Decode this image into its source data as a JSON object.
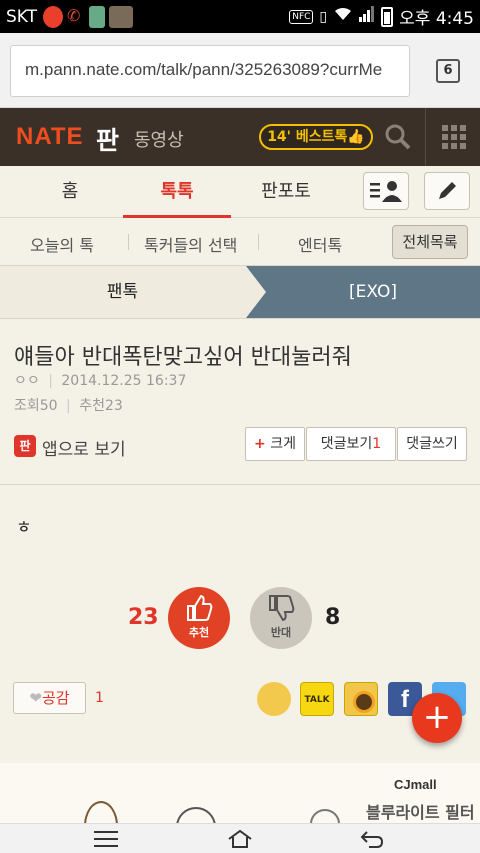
{
  "status_bar": {
    "carrier": "SKT",
    "nfc": "NFC",
    "time": "오후 4:45"
  },
  "browser": {
    "url": "m.pann.nate.com/talk/pann/325263089?currMe",
    "tab_count": "6"
  },
  "header": {
    "logo": "NATE",
    "section": "판",
    "video_link": "동영상",
    "best_talk": "14' 베스트톡👍"
  },
  "tabs": [
    {
      "label": "홈"
    },
    {
      "label": "톡톡",
      "active": true
    },
    {
      "label": "판포토"
    }
  ],
  "submenu": {
    "items": [
      "오늘의 톡",
      "톡커들의 선택",
      "엔터톡"
    ],
    "all_list": "전체목록"
  },
  "breadcrumb": {
    "left": "팬톡",
    "right": "[EXO]"
  },
  "post": {
    "title": "얘들아 반대폭탄맞고싶어 반대눌러줘",
    "author": "ㅇㅇ",
    "date": "2014.12.25 16:37",
    "views_label": "조회50",
    "recommends_label": "추천23",
    "app_badge": "판",
    "app_view": "앱으로 보기",
    "actions": {
      "bigger_plus": "+",
      "bigger": "크게",
      "view_comments": "댓글보기",
      "comment_count": "1",
      "write_comment": "댓글쓰기"
    },
    "body": "ㅎ"
  },
  "votes": {
    "up_count": "23",
    "up_label": "추천",
    "down_count": "8",
    "down_label": "반대"
  },
  "empathy": {
    "label": "공감",
    "count": "1"
  },
  "share": {
    "kakao_talk": "TALK",
    "facebook": "f"
  },
  "fab": "+",
  "ad": {
    "brand": "CJmall",
    "text": "블루라이트 필터"
  },
  "colors": {
    "accent_red": "#e0352a",
    "header_bg": "#3b3028",
    "crumb_blue": "#5f7687",
    "best_yellow": "#f2c000"
  }
}
